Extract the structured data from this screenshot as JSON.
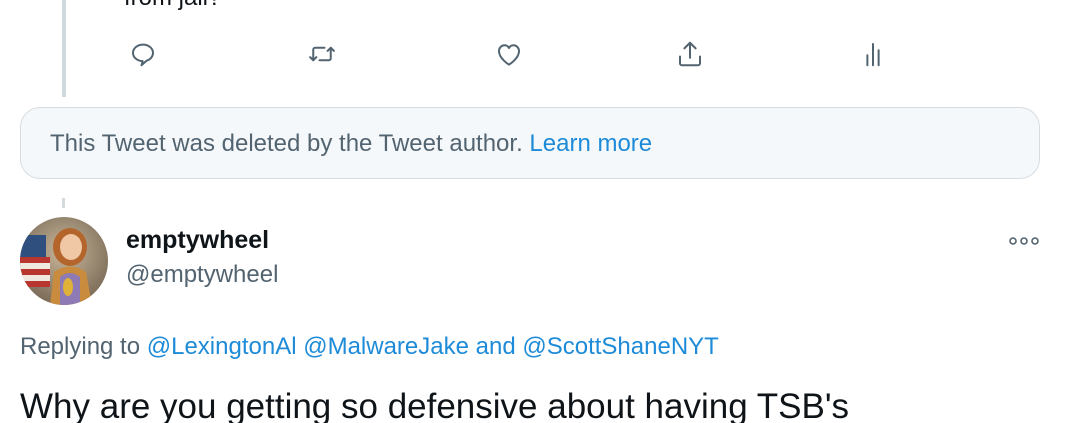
{
  "previous_tweet": {
    "text_tail": "from jail?",
    "actions": [
      {
        "name": "reply-icon"
      },
      {
        "name": "retweet-icon"
      },
      {
        "name": "like-icon"
      },
      {
        "name": "share-icon"
      },
      {
        "name": "analytics-icon"
      }
    ]
  },
  "deleted_notice": {
    "text": "This Tweet was deleted by the Tweet author.",
    "link": "Learn more"
  },
  "tweet": {
    "display_name": "emptywheel",
    "handle": "@emptywheel",
    "replying_prefix": "Replying to",
    "mentions": [
      "@LexingtonAl",
      "@MalwareJake"
    ],
    "replying_and": "and",
    "mention_last": "@ScottShaneNYT",
    "text": "Why are you getting so defensive about having TSB's"
  },
  "colors": {
    "link": "#1d8bd8",
    "secondary_text": "#536471",
    "icon": "#536471"
  }
}
